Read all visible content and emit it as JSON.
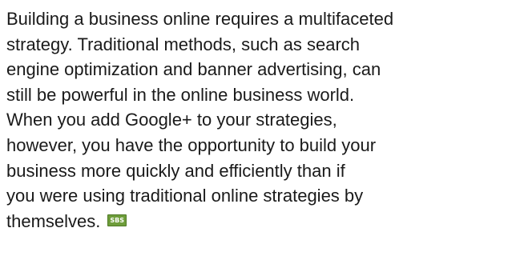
{
  "article": {
    "lines": [
      "Building a business online requires a multifaceted",
      "strategy. Traditional methods, such as search",
      "engine optimization and banner advertising, can",
      "still be powerful in the online business world.",
      "When you add Google+ to your strategies,",
      "however, you have the opportunity to build your",
      "business more quickly and efficiently than if",
      "you were using traditional online strategies by",
      "themselves."
    ],
    "end_mark_label": "SBS"
  },
  "colors": {
    "text": "#1a1a1a",
    "end_mark_background": "#6e9d3b"
  }
}
